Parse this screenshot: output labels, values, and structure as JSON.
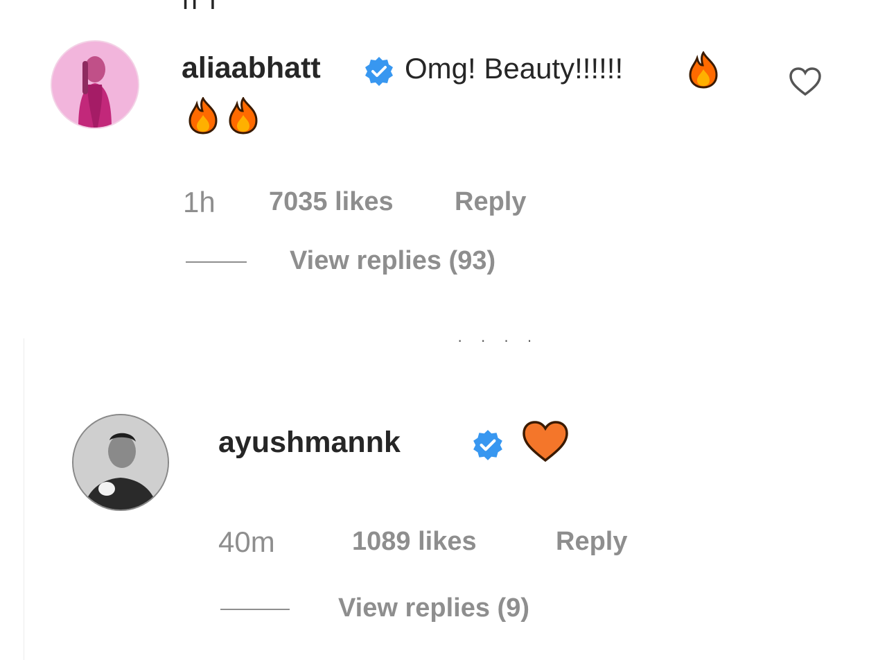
{
  "comments": [
    {
      "username": "aliaabhatt",
      "verified": true,
      "text": "Omg! Beauty!!!!!!",
      "emojis": [
        "fire",
        "fire",
        "fire"
      ],
      "time": "1h",
      "likes": "7035 likes",
      "reply_label": "Reply",
      "view_replies": "View replies (93)",
      "avatar_icon": "profile-photo",
      "like_icon": "heart-outline-icon"
    },
    {
      "username": "ayushmannk",
      "verified": true,
      "text": "",
      "emojis": [
        "orange-heart"
      ],
      "time": "40m",
      "likes": "1089 likes",
      "reply_label": "Reply",
      "view_replies": "View replies (9)",
      "avatar_icon": "profile-photo"
    }
  ],
  "colors": {
    "username": "#262626",
    "meta": "#8e8e8e",
    "verified_badge": "#3897f0",
    "fire": "#ff6a00",
    "orange_heart": "#f4762a"
  }
}
